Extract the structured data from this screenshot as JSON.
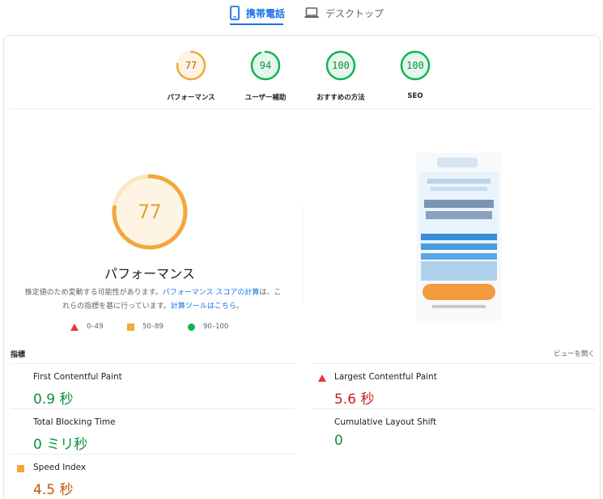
{
  "tabs": {
    "mobile": "携帯電話",
    "desktop": "デスクトップ"
  },
  "categories": [
    {
      "score": "77",
      "label": "パフォーマンス",
      "value": 77,
      "color": "#f2a83b",
      "fill": "#fdf4e4"
    },
    {
      "score": "94",
      "label": "ユーザー補助",
      "value": 94,
      "color": "#10b553",
      "fill": "#e6f6ec"
    },
    {
      "score": "100",
      "label": "おすすめの方法",
      "value": 100,
      "color": "#10b553",
      "fill": "#e6f6ec"
    },
    {
      "score": "100",
      "label": "SEO",
      "value": 100,
      "color": "#10b553",
      "fill": "#e6f6ec"
    }
  ],
  "performance": {
    "score": "77",
    "value": 77,
    "title": "パフォーマンス",
    "desc_part1": "推定値のため変動する可能性があります。",
    "desc_link1": "パフォーマンス スコアの計算",
    "desc_part2": "は、これらの指標を基に行っています。",
    "desc_link2": "計算ツールはこちら",
    "desc_end": "。"
  },
  "legend": {
    "poor": "0–49",
    "average": "50–89",
    "good": "90–100"
  },
  "metrics_header": {
    "title": "指標",
    "expand": "ビューを開く"
  },
  "metrics": [
    {
      "name": "First Contentful Paint",
      "value": "0.9 秒",
      "status": "good"
    },
    {
      "name": "Largest Contentful Paint",
      "value": "5.6 秒",
      "status": "poor"
    },
    {
      "name": "Total Blocking Time",
      "value": "0 ミリ秒",
      "status": "good"
    },
    {
      "name": "Cumulative Layout Shift",
      "value": "0",
      "status": "good"
    },
    {
      "name": "Speed Index",
      "value": "4.5 秒",
      "status": "average"
    }
  ],
  "colors": {
    "accent": "#1a73e8",
    "good": "#10b553",
    "average": "#f2a83b",
    "poor": "#e53935"
  }
}
